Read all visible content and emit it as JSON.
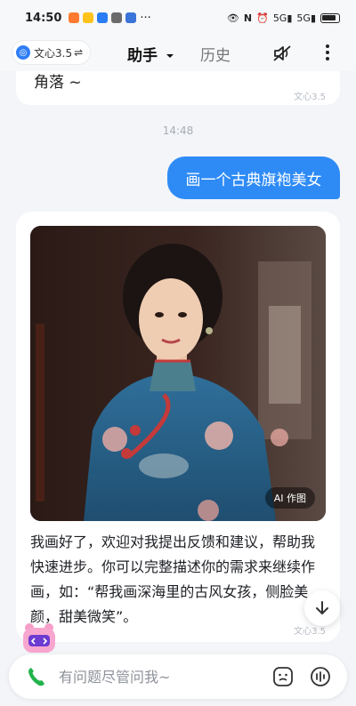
{
  "status_bar": {
    "time": "14:50",
    "dots": "···",
    "net1": "5G",
    "net2": "5G"
  },
  "header": {
    "model_label": "文心3.5",
    "switch_glyph": "⇌",
    "tab_assistant": "助手",
    "tab_history": "历史"
  },
  "chat": {
    "prev_text": "角落 ~",
    "prev_tag": "文心3.5",
    "timestamp": "14:48",
    "user_message": "画一个古典旗袍美女",
    "image_badge": "AI 作图",
    "reply_text": "我画好了，欢迎对我提出反馈和建议，帮助我快速进步。你可以完整描述你的需求来继续作画，如：“帮我画深海里的古风女孩，侧脸美颜，甜美微笑”。",
    "reply_tag": "文心3.5"
  },
  "input": {
    "placeholder": "有问题尽管问我~"
  },
  "colors": {
    "accent": "#2e8bf6",
    "call_green": "#22b34c"
  },
  "icons": [
    "mute-icon",
    "more-icon",
    "chevron-down-icon",
    "arrow-down-icon",
    "phone-icon",
    "emoji-icon",
    "voice-icon"
  ]
}
